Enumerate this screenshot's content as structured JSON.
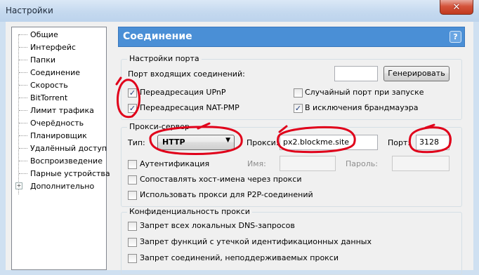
{
  "window": {
    "title": "Настройки",
    "close_glyph": "✕"
  },
  "tree": {
    "items": [
      {
        "label": "Общие"
      },
      {
        "label": "Интерфейс"
      },
      {
        "label": "Папки"
      },
      {
        "label": "Соединение",
        "selected": true
      },
      {
        "label": "Скорость"
      },
      {
        "label": "BitTorrent"
      },
      {
        "label": "Лимит трафика"
      },
      {
        "label": "Очерёдность"
      },
      {
        "label": "Планировщик"
      },
      {
        "label": "Удалённый доступ"
      },
      {
        "label": "Воспроизведение"
      },
      {
        "label": "Парные устройства"
      },
      {
        "label": "Дополнительно",
        "expander": "+"
      }
    ]
  },
  "header": {
    "title": "Соединение",
    "help": "?"
  },
  "port_settings": {
    "title": "Настройки порта",
    "incoming_label": "Порт входящих соединений:",
    "incoming_value": "",
    "generate_button": "Генерировать",
    "upnp": {
      "label": "Переадресация UPnP",
      "checked": true
    },
    "natpmp": {
      "label": "Переадресация NAT-PMP",
      "checked": true
    },
    "random_port": {
      "label": "Случайный порт при запуске",
      "checked": false
    },
    "firewall": {
      "label": "В исключения брандмауэра",
      "checked": true
    }
  },
  "proxy": {
    "title": "Прокси-сервер",
    "type_label": "Тип:",
    "type_value": "HTTP",
    "proxy_label": "Прокси:",
    "proxy_value": "px2.blockme.site",
    "port_label": "Порт:",
    "port_value": "3128",
    "auth": {
      "label": "Аутентификация",
      "checked": false
    },
    "name_label": "Имя:",
    "name_value": "",
    "password_label": "Пароль:",
    "password_value": "",
    "resolve_hostnames": {
      "label": "Сопоставлять хост-имена через прокси",
      "checked": false
    },
    "p2p": {
      "label": "Использовать прокси для P2P-соединений",
      "checked": false
    }
  },
  "privacy": {
    "title": "Конфиденциальность прокси",
    "dns": {
      "label": "Запрет всех локальных DNS-запросов",
      "checked": false
    },
    "leak": {
      "label": "Запрет функций с утечкой идентификационных данных",
      "checked": false
    },
    "unsupported": {
      "label": "Запрет соединений, неподдерживаемых прокси",
      "checked": false
    }
  },
  "colors": {
    "header_bg": "#4a8fd6",
    "annotation": "#e0001a"
  },
  "check_glyph": "✓",
  "dropdown_arrow": "▼"
}
